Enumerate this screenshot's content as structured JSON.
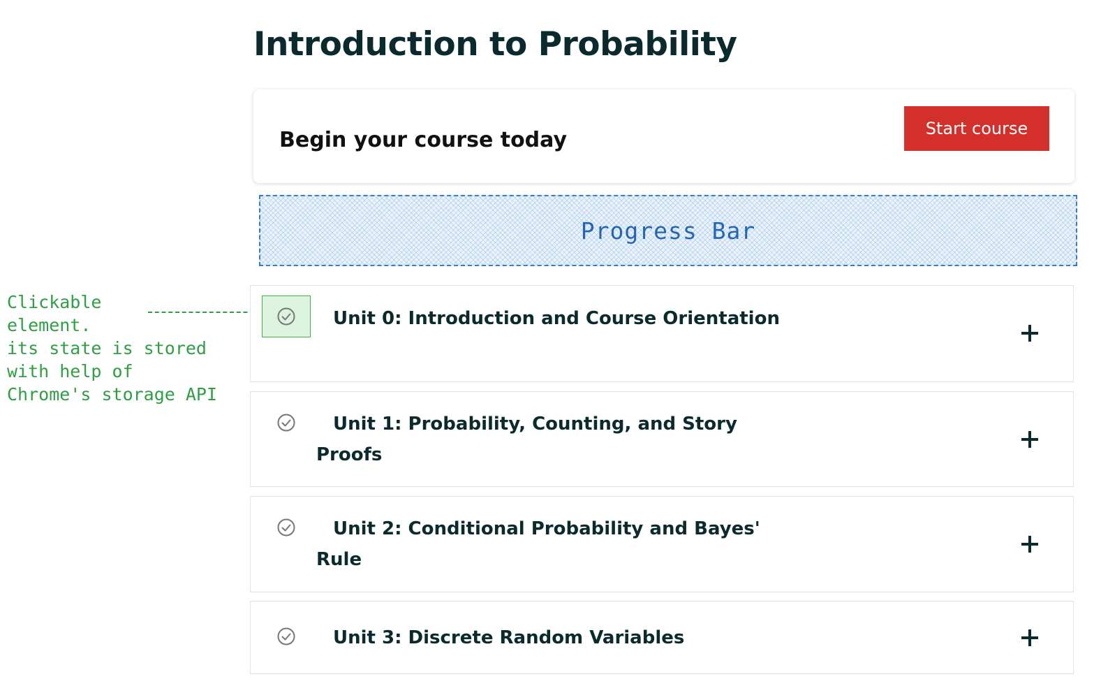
{
  "page": {
    "title": "Introduction to Probability"
  },
  "begin_card": {
    "text": "Begin your course today",
    "button_label": "Start course",
    "button_color": "#d4302b"
  },
  "progress_bar": {
    "label": "Progress Bar"
  },
  "annotation": {
    "text": "Clickable\nelement.\nits state is stored\nwith help of\nChrome's storage API",
    "color": "#2f9e44"
  },
  "units": [
    {
      "title": "Unit 0: Introduction and Course Orientation",
      "check_icon": "circle-check-icon",
      "expand_icon": "plus-icon"
    },
    {
      "title": "Unit 1: Probability, Counting, and Story Proofs",
      "check_icon": "circle-check-icon",
      "expand_icon": "plus-icon"
    },
    {
      "title": "Unit 2: Conditional Probability and Bayes' Rule",
      "check_icon": "circle-check-icon",
      "expand_icon": "plus-icon"
    },
    {
      "title": "Unit 3: Discrete Random Variables",
      "check_icon": "circle-check-icon",
      "expand_icon": "plus-icon"
    }
  ]
}
